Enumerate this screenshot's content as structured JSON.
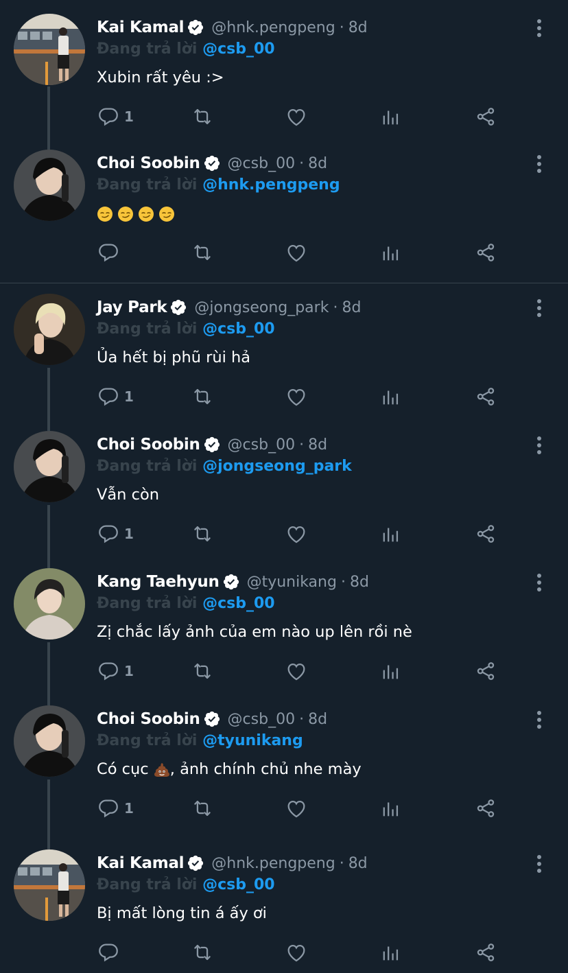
{
  "tweets": [
    {
      "name": "Kai Kamal",
      "handle": "@hnk.pengpeng",
      "time": "8d",
      "reply_prefix": "Đang trả lời",
      "reply_to": "@csb_00",
      "text": "Xubin rất yêu :>",
      "reply_count": "1",
      "avatar": "kai"
    },
    {
      "name": "Choi Soobin",
      "handle": "@csb_00",
      "time": "8d",
      "reply_prefix": "Đang trả lời",
      "reply_to": "@hnk.pengpeng",
      "text": "",
      "emoji": "smirk x4",
      "reply_count": "",
      "avatar": "soobin"
    },
    {
      "name": "Jay Park",
      "handle": "@jongseong_park",
      "time": "8d",
      "reply_prefix": "Đang trả lời",
      "reply_to": "@csb_00",
      "text": "Ủa hết bị phũ rùi hả",
      "reply_count": "1",
      "avatar": "jay"
    },
    {
      "name": "Choi Soobin",
      "handle": "@csb_00",
      "time": "8d",
      "reply_prefix": "Đang trả lời",
      "reply_to": "@jongseong_park",
      "text": "Vẫn còn",
      "reply_count": "1",
      "avatar": "soobin"
    },
    {
      "name": "Kang Taehyun",
      "handle": "@tyunikang",
      "time": "8d",
      "reply_prefix": "Đang trả lời",
      "reply_to": "@csb_00",
      "text": "Zị chắc lấy ảnh của em nào up lên rồi nè",
      "reply_count": "1",
      "avatar": "taehyun"
    },
    {
      "name": "Choi Soobin",
      "handle": "@csb_00",
      "time": "8d",
      "reply_prefix": "Đang trả lời",
      "reply_to": "@tyunikang",
      "text_before": "Có cục",
      "text_after": ", ảnh chính chủ nhe mày",
      "emoji": "pile-of-poo",
      "reply_count": "1",
      "avatar": "soobin"
    },
    {
      "name": "Kai Kamal",
      "handle": "@hnk.pengpeng",
      "time": "8d",
      "reply_prefix": "Đang trả lời",
      "reply_to": "@csb_00",
      "text": "Bị mất lòng tin á ấy ơi",
      "reply_count": "",
      "avatar": "kai"
    }
  ],
  "colors": {
    "background": "#15202b",
    "accent": "#1d9bf0",
    "muted": "#8b98a5",
    "divider": "#38444d"
  },
  "icons": [
    "verified-badge-icon",
    "more-vertical-icon",
    "reply-icon",
    "retweet-icon",
    "like-icon",
    "analytics-icon",
    "share-icon"
  ]
}
